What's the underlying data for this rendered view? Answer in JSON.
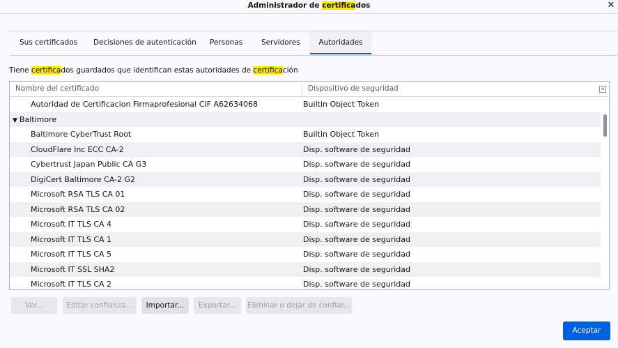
{
  "window": {
    "title_before": "Administrador de ",
    "title_highlight": "certifica",
    "title_after": "dos",
    "close_glyph": "✕"
  },
  "tabs": [
    {
      "label": "Sus certificados"
    },
    {
      "label": "Decisiones de autenticación"
    },
    {
      "label": "Personas"
    },
    {
      "label": "Servidores"
    },
    {
      "label": "Autoridades",
      "active": true
    }
  ],
  "heading": {
    "part1": "Tiene ",
    "hl1": "certifica",
    "part2": "dos guardados que identifican estas autoridades de ",
    "hl2": "certifica",
    "part3": "ción"
  },
  "table": {
    "col_name": "Nombre del certificado",
    "col_device": "Dispositivo de seguridad",
    "rows": [
      {
        "name": "Autoridad de Certificacion Firmaprofesional CIF A62634068",
        "device": "Builtin Object Token"
      },
      {
        "group": true,
        "name": "Baltimore",
        "device": ""
      },
      {
        "name": "Baltimore CyberTrust Root",
        "device": "Builtin Object Token"
      },
      {
        "name": "CloudFlare Inc ECC CA-2",
        "device": "Disp. software de seguridad"
      },
      {
        "name": "Cybertrust Japan Public CA G3",
        "device": "Disp. software de seguridad"
      },
      {
        "name": "DigiCert Baltimore CA-2 G2",
        "device": "Disp. software de seguridad"
      },
      {
        "name": "Microsoft RSA TLS CA 01",
        "device": "Disp. software de seguridad"
      },
      {
        "name": "Microsoft RSA TLS CA 02",
        "device": "Disp. software de seguridad"
      },
      {
        "name": "Microsoft IT TLS CA 4",
        "device": "Disp. software de seguridad"
      },
      {
        "name": "Microsoft IT TLS CA 1",
        "device": "Disp. software de seguridad"
      },
      {
        "name": "Microsoft IT TLS CA 5",
        "device": "Disp. software de seguridad"
      },
      {
        "name": "Microsoft IT SSL SHA2",
        "device": "Disp. software de seguridad"
      },
      {
        "name": "Microsoft IT TLS CA 2",
        "device": "Disp. software de seguridad"
      }
    ]
  },
  "buttons": {
    "ver": "Ver...",
    "editar": "Editar confianza...",
    "importar": "Importar...",
    "exportar": "Exportar...",
    "eliminar": "Eliminar o dejar de confiar...",
    "aceptar": "Aceptar"
  },
  "colors": {
    "accent": "#0061e0",
    "highlight": "#ffe900"
  }
}
